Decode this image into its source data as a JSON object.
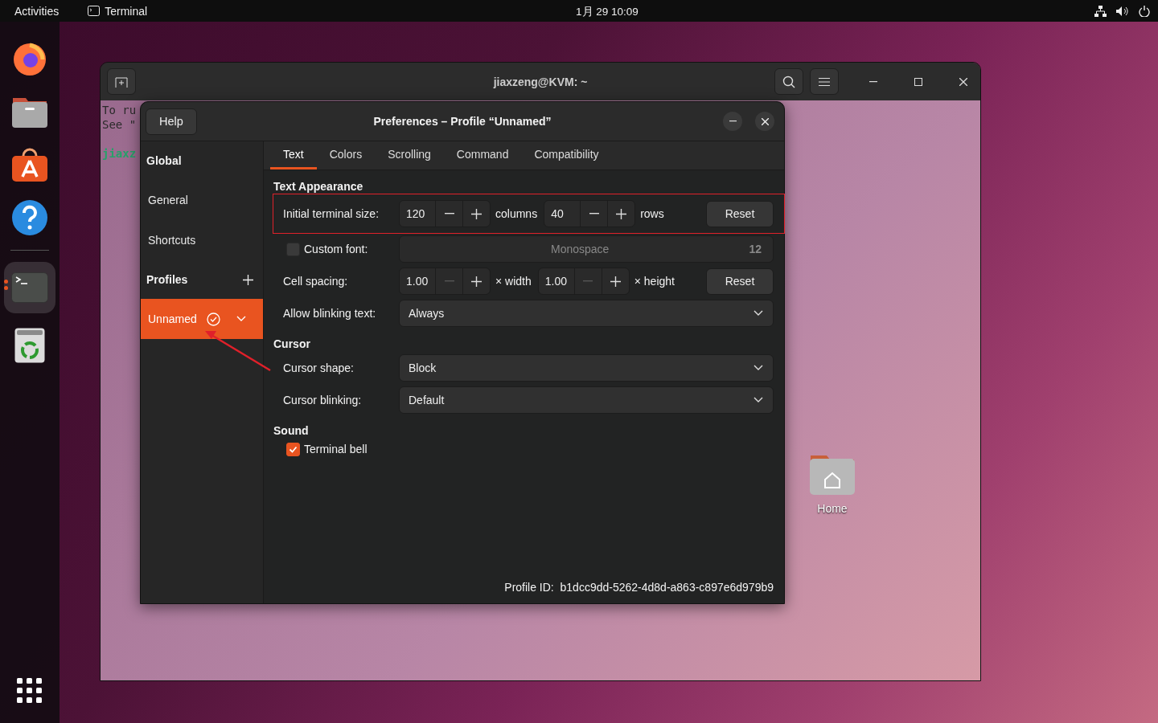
{
  "top_bar": {
    "activities": "Activities",
    "app_name": "Terminal",
    "clock": "1月 29  10:09"
  },
  "dock": [
    {
      "kind": "firefox",
      "running": false,
      "selected": false
    },
    {
      "kind": "files",
      "running": false,
      "selected": false
    },
    {
      "kind": "store",
      "running": false,
      "selected": false
    },
    {
      "kind": "help",
      "running": false,
      "selected": false
    },
    {
      "kind": "terminal",
      "running": true,
      "selected": true
    },
    {
      "kind": "trash",
      "running": false,
      "selected": false
    },
    {
      "kind": "apps",
      "running": false,
      "selected": false
    }
  ],
  "desktop_icons": [
    {
      "label": "Home"
    }
  ],
  "terminal": {
    "title": "jiaxzeng@KVM: ~",
    "lines": [
      {
        "text": "To ru",
        "kind": "plain"
      },
      {
        "text": "See \"",
        "kind": "plain"
      },
      {
        "kind": "blank"
      },
      {
        "text": "jiaxz",
        "kind": "prompt"
      }
    ]
  },
  "dialog": {
    "title": "Preferences – Profile “Unnamed”",
    "help": "Help",
    "sidebar": [
      {
        "kind": "heading",
        "label": "Global",
        "add": false
      },
      {
        "kind": "item",
        "label": "General",
        "selected": false
      },
      {
        "kind": "item",
        "label": "Shortcuts",
        "selected": false
      },
      {
        "kind": "heading",
        "label": "Profiles",
        "add": true
      },
      {
        "kind": "profile",
        "label": "Unnamed",
        "selected": true,
        "default": true
      }
    ],
    "tabs": [
      {
        "label": "Text",
        "selected": true
      },
      {
        "label": "Colors",
        "selected": false
      },
      {
        "label": "Scrolling",
        "selected": false
      },
      {
        "label": "Command",
        "selected": false
      },
      {
        "label": "Compatibility",
        "selected": false
      }
    ],
    "sections": [
      {
        "title": "Text Appearance",
        "rows": [
          {
            "kind": "steppers",
            "label": "Initial terminal size:",
            "highlighted": true,
            "steppers": [
              {
                "value": "120",
                "unit": "columns",
                "minus_disabled": false
              },
              {
                "value": "40",
                "unit": "rows",
                "minus_disabled": false
              }
            ],
            "button": "Reset"
          },
          {
            "kind": "font",
            "label": "Custom font:",
            "checked": false,
            "font": "Monospace",
            "size": "12"
          },
          {
            "kind": "steppers",
            "label": "Cell spacing:",
            "highlighted": false,
            "steppers": [
              {
                "value": "1.00",
                "unit": "× width",
                "minus_disabled": true
              },
              {
                "value": "1.00",
                "unit": "× height",
                "minus_disabled": true
              }
            ],
            "button": "Reset"
          },
          {
            "kind": "dropdown",
            "label": "Allow blinking text:",
            "value": "Always"
          }
        ]
      },
      {
        "title": "Cursor",
        "rows": [
          {
            "kind": "dropdown",
            "label": "Cursor shape:",
            "value": "Block"
          },
          {
            "kind": "dropdown",
            "label": "Cursor blinking:",
            "value": "Default"
          }
        ]
      },
      {
        "title": "Sound",
        "rows": [
          {
            "kind": "check",
            "label": "Terminal bell",
            "checked": true
          }
        ]
      }
    ],
    "profile_id_label": "Profile ID:",
    "profile_id": "b1dcc9dd-5262-4d8d-a863-c897e6d979b9"
  }
}
